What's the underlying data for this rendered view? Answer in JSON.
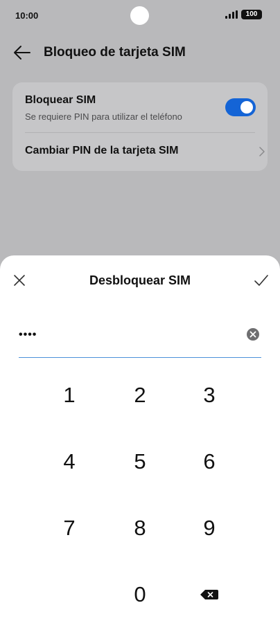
{
  "status_bar": {
    "time": "10:00",
    "battery": "100"
  },
  "header": {
    "title": "Bloqueo de tarjeta SIM",
    "back_icon": "arrow-left-icon"
  },
  "settings": {
    "lock_sim": {
      "title": "Bloquear SIM",
      "subtitle": "Se requiere PIN para utilizar el teléfono",
      "enabled": true
    },
    "change_pin": {
      "title": "Cambiar PIN de la tarjeta SIM"
    }
  },
  "sheet": {
    "title": "Desbloquear SIM",
    "pin_value": "••••",
    "keys": [
      "1",
      "2",
      "3",
      "4",
      "5",
      "6",
      "7",
      "8",
      "9",
      "0"
    ]
  },
  "colors": {
    "accent": "#1464d6",
    "input_underline": "#4a90d9",
    "dimmed_background": "#b9b9bb"
  }
}
